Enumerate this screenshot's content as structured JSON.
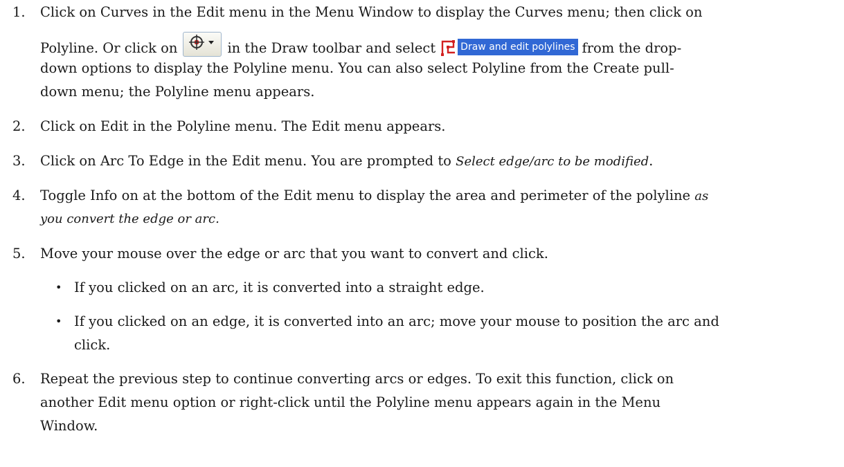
{
  "steps": [
    {
      "number": "1.",
      "line1": "Click on Curves in the Edit menu in the Menu Window to display the Curves menu; then click on",
      "line2_a": "Polyline. Or click on",
      "line2_b": "in the Draw toolbar and select",
      "line2_c": "from the drop-",
      "line3": "down options to display the Polyline menu. You can also select Polyline from the Create pull-",
      "line4": "down menu; the Polyline menu appears."
    },
    {
      "number": "2.",
      "line1": "Click on Edit in the Polyline menu. The Edit menu appears."
    },
    {
      "number": "3.",
      "line1_a": "Click on Arc To Edge in the Edit menu. You are prompted to",
      "line1_italic": "Select edge/arc to be modified",
      "line1_b": "."
    },
    {
      "number": "4.",
      "line1_a": "Toggle Info on at the bottom of the Edit menu to display the area and perimeter of the polyline",
      "line1_italic": "as",
      "line2_italic": "you convert the edge or arc."
    },
    {
      "number": "5.",
      "line1": "Move your mouse over the edge or arc that you want to convert and click."
    },
    {
      "number": "6.",
      "line1": "Repeat the previous step to continue converting arcs or edges. To exit this function, click on",
      "line2": "another Edit menu option or right-click until the Polyline menu appears again in the Menu",
      "line3": "Window."
    }
  ],
  "bullets": [
    {
      "symbol": "•",
      "line1": "If you clicked on an arc, it is converted into a straight edge."
    },
    {
      "symbol": "•",
      "line1": "If you clicked on an edge, it is converted into an arc; move your mouse to position the arc and",
      "line2": "click."
    }
  ],
  "inline_ui": {
    "toolbar_button_icon": "target-crosshair-dropdown-icon",
    "menu_item_icon": "polyline-draw-icon",
    "menu_item_label": "Draw and edit polylines",
    "menu_highlight_color": "#3168d5",
    "polyline_icon_color": "#d22020"
  }
}
